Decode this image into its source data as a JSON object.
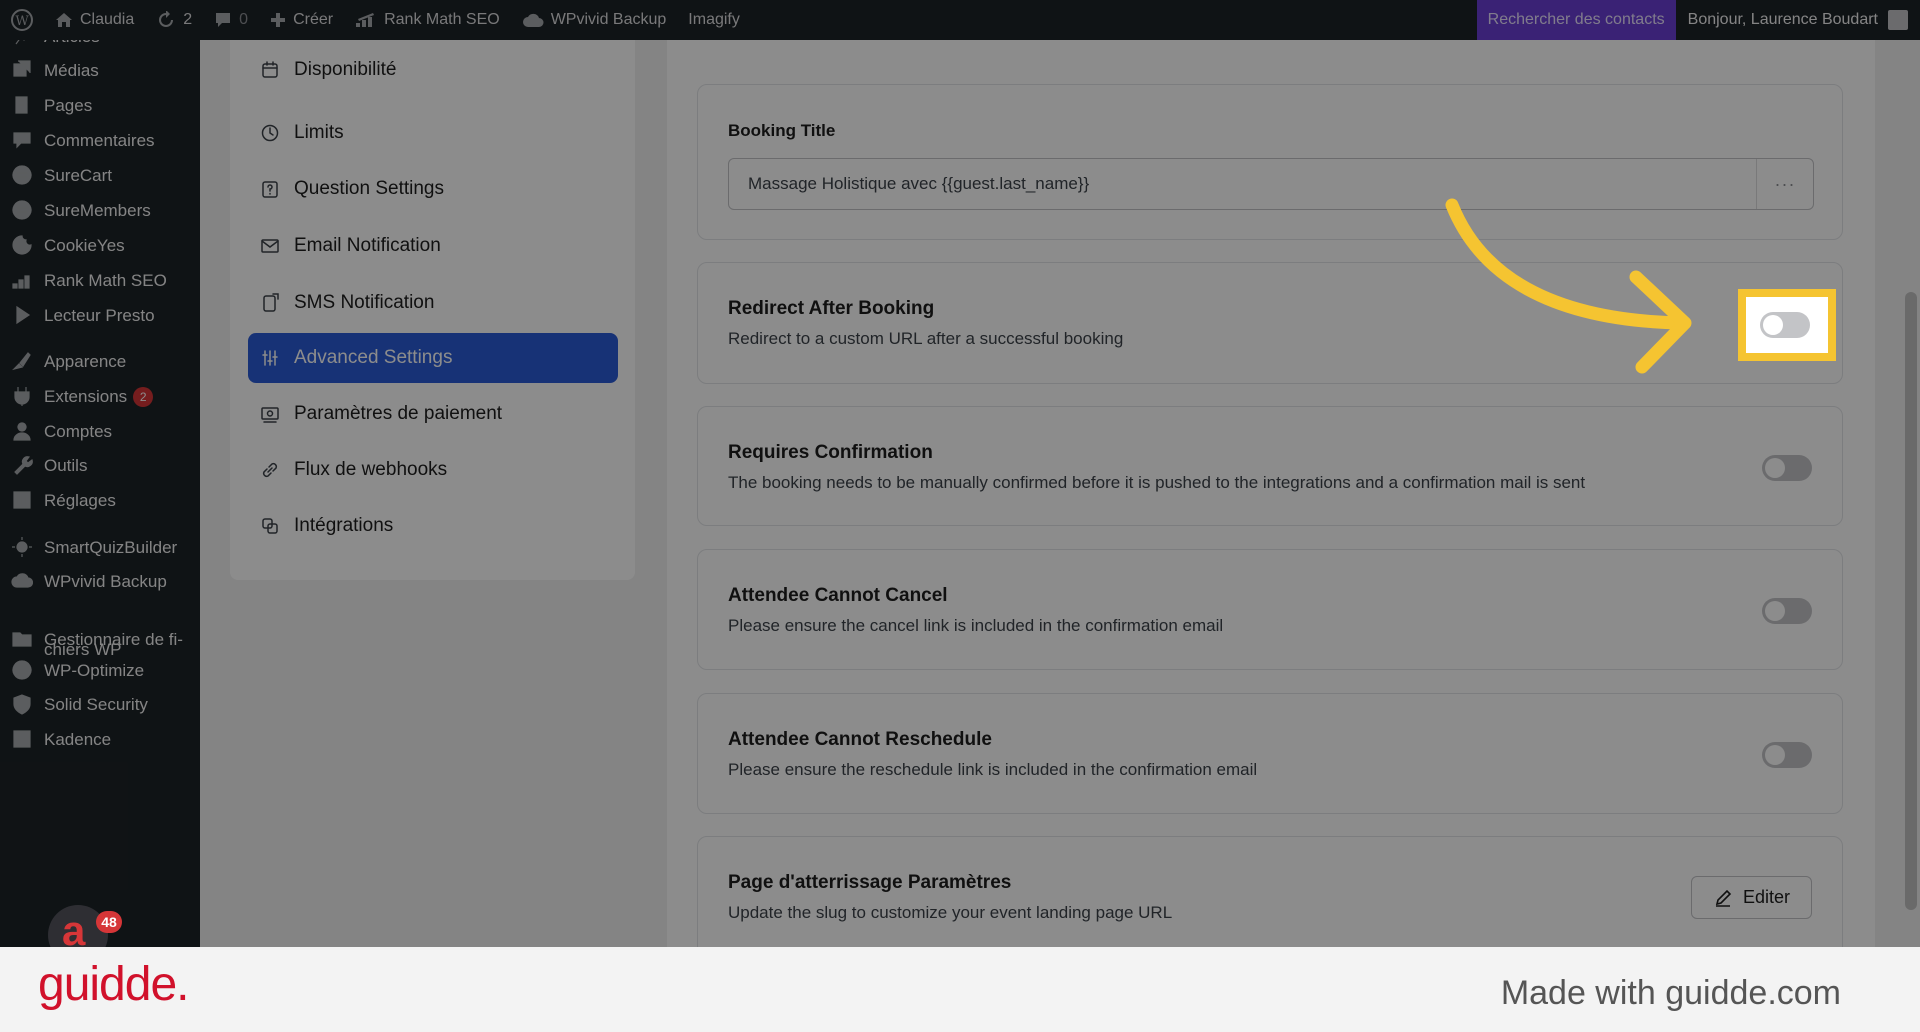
{
  "admin_bar": {
    "site_name": "Claudia",
    "updates_count": "2",
    "comments_count": "0",
    "new_label": "Créer",
    "rankmath_label": "Rank Math SEO",
    "wpvivid_label": "WPvivid Backup",
    "imagify_label": "Imagify",
    "search_contacts_label": "Rechercher des contacts",
    "greeting": "Bonjour, Laurence Boudart"
  },
  "sidebar": {
    "items": [
      {
        "label": "Articles",
        "icon": "pin-icon"
      },
      {
        "label": "Médias",
        "icon": "media-icon"
      },
      {
        "label": "Pages",
        "icon": "pages-icon"
      },
      {
        "label": "Commentaires",
        "icon": "comment-icon"
      },
      {
        "label": "SureCart",
        "icon": "surecart-icon"
      },
      {
        "label": "SureMembers",
        "icon": "suremembers-icon"
      },
      {
        "label": "CookieYes",
        "icon": "cookie-icon"
      },
      {
        "label": "Rank Math SEO",
        "icon": "chart-icon"
      },
      {
        "label": "Lecteur Presto",
        "icon": "play-icon"
      },
      {
        "label": "Apparence",
        "icon": "brush-icon"
      },
      {
        "label": "Extensions",
        "icon": "plugin-icon",
        "badge": "2"
      },
      {
        "label": "Comptes",
        "icon": "user-icon"
      },
      {
        "label": "Outils",
        "icon": "wrench-icon"
      },
      {
        "label": "Réglages",
        "icon": "settings-icon"
      },
      {
        "label": "SmartQuizBuilder",
        "icon": "gear-icon"
      },
      {
        "label": "WPvivid Backup",
        "icon": "cloud-icon"
      },
      {
        "label": "Gestionnaire de fi-",
        "label2": "chiers WP",
        "icon": "folder-icon"
      },
      {
        "label": "WP-Optimize",
        "icon": "optimize-icon"
      },
      {
        "label": "Solid Security",
        "icon": "shield-icon"
      },
      {
        "label": "Kadence",
        "icon": "kadence-icon"
      }
    ]
  },
  "settings_nav": {
    "items": [
      {
        "label": "Disponibilité",
        "icon": "calendar-icon"
      },
      {
        "label": "Limits",
        "icon": "clock-icon"
      },
      {
        "label": "Question Settings",
        "icon": "question-icon"
      },
      {
        "label": "Email Notification",
        "icon": "mail-icon"
      },
      {
        "label": "SMS Notification",
        "icon": "sms-icon"
      },
      {
        "label": "Advanced Settings",
        "icon": "sliders-icon",
        "active": true
      },
      {
        "label": "Paramètres de paiement",
        "icon": "payment-icon"
      },
      {
        "label": "Flux de webhooks",
        "icon": "link-icon"
      },
      {
        "label": "Intégrations",
        "icon": "integrations-icon"
      }
    ]
  },
  "content": {
    "booking_title": {
      "label": "Booking Title",
      "value": "Massage Holistique avec {{guest.last_name}}",
      "more": "···"
    },
    "redirect": {
      "title": "Redirect After Booking",
      "description": "Redirect to a custom URL after a successful booking",
      "enabled": false
    },
    "requires_confirmation": {
      "title": "Requires Confirmation",
      "description": "The booking needs to be manually confirmed before it is pushed to the integrations and a confirmation mail is sent",
      "enabled": false
    },
    "cannot_cancel": {
      "title": "Attendee Cannot Cancel",
      "description": "Please ensure the cancel link is included in the confirmation email",
      "enabled": false
    },
    "cannot_reschedule": {
      "title": "Attendee Cannot Reschedule",
      "description": "Please ensure the reschedule link is included in the confirmation email",
      "enabled": false
    },
    "landing_page": {
      "title": "Page d'atterrissage Paramètres",
      "description": "Update the slug to customize your event landing page URL",
      "edit_label": "Editer"
    }
  },
  "notification_bubble": {
    "count": "48"
  },
  "footer": {
    "logo": "guidde.",
    "made_with": "Made with guidde.com"
  },
  "colors": {
    "highlight": "#f5c431",
    "active_nav": "#2a5bd7",
    "brand": "#d1112b"
  }
}
